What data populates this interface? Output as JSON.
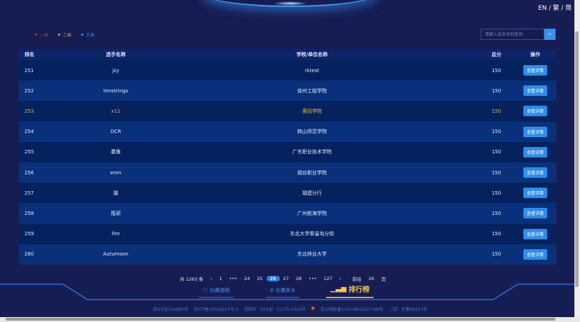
{
  "lang": "EN / 繁 / 简",
  "legend": [
    {
      "label": "一血",
      "color": "#d0303a"
    },
    {
      "label": "二血",
      "color": "#e0b040"
    },
    {
      "label": "三血",
      "color": "#3a8ef0"
    }
  ],
  "search": {
    "placeholder": "请输入选手名称查询",
    "icon": "search-icon"
  },
  "table": {
    "headers": [
      "排名",
      "选手名称",
      "学校/单位名称",
      "总分",
      "操作"
    ],
    "rows": [
      {
        "rank": "251",
        "name": "jzy",
        "school": "rktest",
        "score": "150",
        "action": "查看详情"
      },
      {
        "rank": "252",
        "name": "tenstrings",
        "school": "徐州工程学院",
        "score": "150",
        "action": "查看详情"
      },
      {
        "rank": "253",
        "name": "x11",
        "school": "莆田学院",
        "score": "150",
        "action": "查看详情",
        "highlight": "#e8b84a"
      },
      {
        "rank": "254",
        "name": "DCR",
        "school": "韩山师范学院",
        "score": "150",
        "action": "查看详情"
      },
      {
        "rank": "255",
        "name": "霍雅",
        "school": "广东职业技术学院",
        "score": "150",
        "action": "查看详情"
      },
      {
        "rank": "256",
        "name": "eren",
        "school": "烟台职业学院",
        "score": "150",
        "action": "查看详情"
      },
      {
        "rank": "257",
        "name": "猫",
        "school": "福建分行",
        "score": "150",
        "action": "查看详情"
      },
      {
        "rank": "258",
        "name": "瓶邪",
        "school": "广州航海学院",
        "score": "150",
        "action": "查看详情"
      },
      {
        "rank": "259",
        "name": "fire",
        "school": "东北大学秦皇岛分校",
        "score": "150",
        "action": "查看详情"
      },
      {
        "rank": "260",
        "name": "Autumoon",
        "school": "东北林业大学",
        "score": "150",
        "action": "查看详情"
      }
    ]
  },
  "pager": {
    "total": "共 1263 条",
    "prev": "‹",
    "pages": [
      "1",
      "•••",
      "24",
      "25",
      "26",
      "27",
      "28",
      "•••",
      "127"
    ],
    "current": "26",
    "next": "›",
    "goto_label": "前往",
    "goto_value": "26",
    "page_unit": "页"
  },
  "nav": [
    {
      "label": "比赛说明",
      "icon": "info-icon"
    },
    {
      "label": "比赛关卡",
      "icon": "location-icon"
    },
    {
      "label": "排行榜",
      "icon": "bar-chart-icon",
      "active": true
    }
  ],
  "footer": [
    "京ICP证150695号",
    "京ICP备15029557号-1",
    "京网文（2018）11175-1016号",
    "京公网安备11010802027748号",
    "（京）字第08313号"
  ]
}
